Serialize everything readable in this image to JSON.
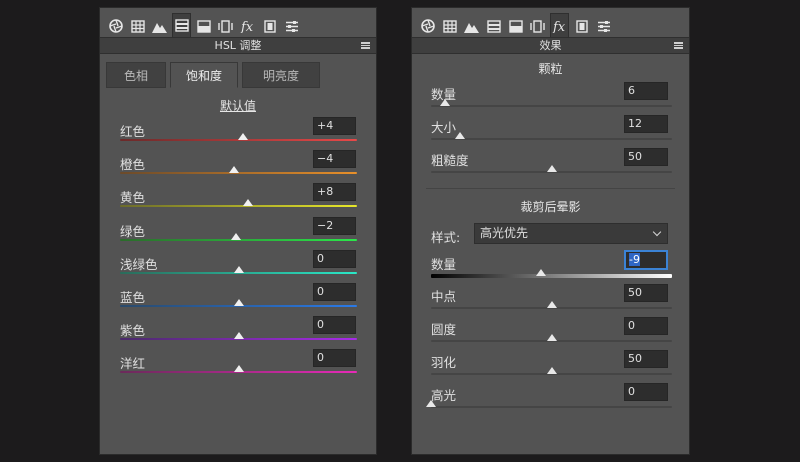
{
  "toolbar_icons": [
    "aperture-icon",
    "grid-icon",
    "mountains-icon",
    "hsl-icon",
    "split-tone-icon",
    "detail-icon",
    "fx-icon",
    "film-icon",
    "sliders-icon"
  ],
  "left": {
    "title": "HSL 调整",
    "tabs": [
      "色相",
      "饱和度",
      "明亮度"
    ],
    "active_tab": "饱和度",
    "default_link": "默认值",
    "rows": [
      {
        "label": "红色",
        "value": "+4",
        "level": 52,
        "gradient": [
          "#6b2a2a",
          "#e84848"
        ]
      },
      {
        "label": "橙色",
        "value": "−4",
        "level": 48,
        "gradient": [
          "#6b4a2a",
          "#e8902a"
        ]
      },
      {
        "label": "黄色",
        "value": "+8",
        "level": 54,
        "gradient": [
          "#6b6b2a",
          "#e8e82a"
        ]
      },
      {
        "label": "绿色",
        "value": "−2",
        "level": 49,
        "gradient": [
          "#2a6b2a",
          "#2ae84a"
        ]
      },
      {
        "label": "浅绿色",
        "value": "0",
        "level": 50,
        "gradient": [
          "#2a6b5a",
          "#2ae8c8"
        ]
      },
      {
        "label": "蓝色",
        "value": "0",
        "level": 50,
        "gradient": [
          "#2a4a6b",
          "#2a7ae8"
        ]
      },
      {
        "label": "紫色",
        "value": "0",
        "level": 50,
        "gradient": [
          "#4a2a6b",
          "#a82ae8"
        ]
      },
      {
        "label": "洋红",
        "value": "0",
        "level": 50,
        "gradient": [
          "#6b2a5a",
          "#e82ab8"
        ]
      }
    ]
  },
  "right": {
    "title": "效果",
    "grain": {
      "title": "颗粒",
      "rows": [
        {
          "label": "数量",
          "value": "6",
          "level": 6
        },
        {
          "label": "大小",
          "value": "12",
          "level": 12
        },
        {
          "label": "粗糙度",
          "value": "50",
          "level": 50
        }
      ]
    },
    "vignette": {
      "title": "裁剪后晕影",
      "style_label": "样式:",
      "style_value": "高光优先",
      "amount_label": "数量",
      "amount_value": "-9",
      "amount_level": 45.5,
      "rows": [
        {
          "label": "中点",
          "value": "50",
          "level": 50
        },
        {
          "label": "圆度",
          "value": "0",
          "level": 50
        },
        {
          "label": "羽化",
          "value": "50",
          "level": 50
        },
        {
          "label": "高光",
          "value": "0",
          "level": 0
        }
      ]
    }
  }
}
